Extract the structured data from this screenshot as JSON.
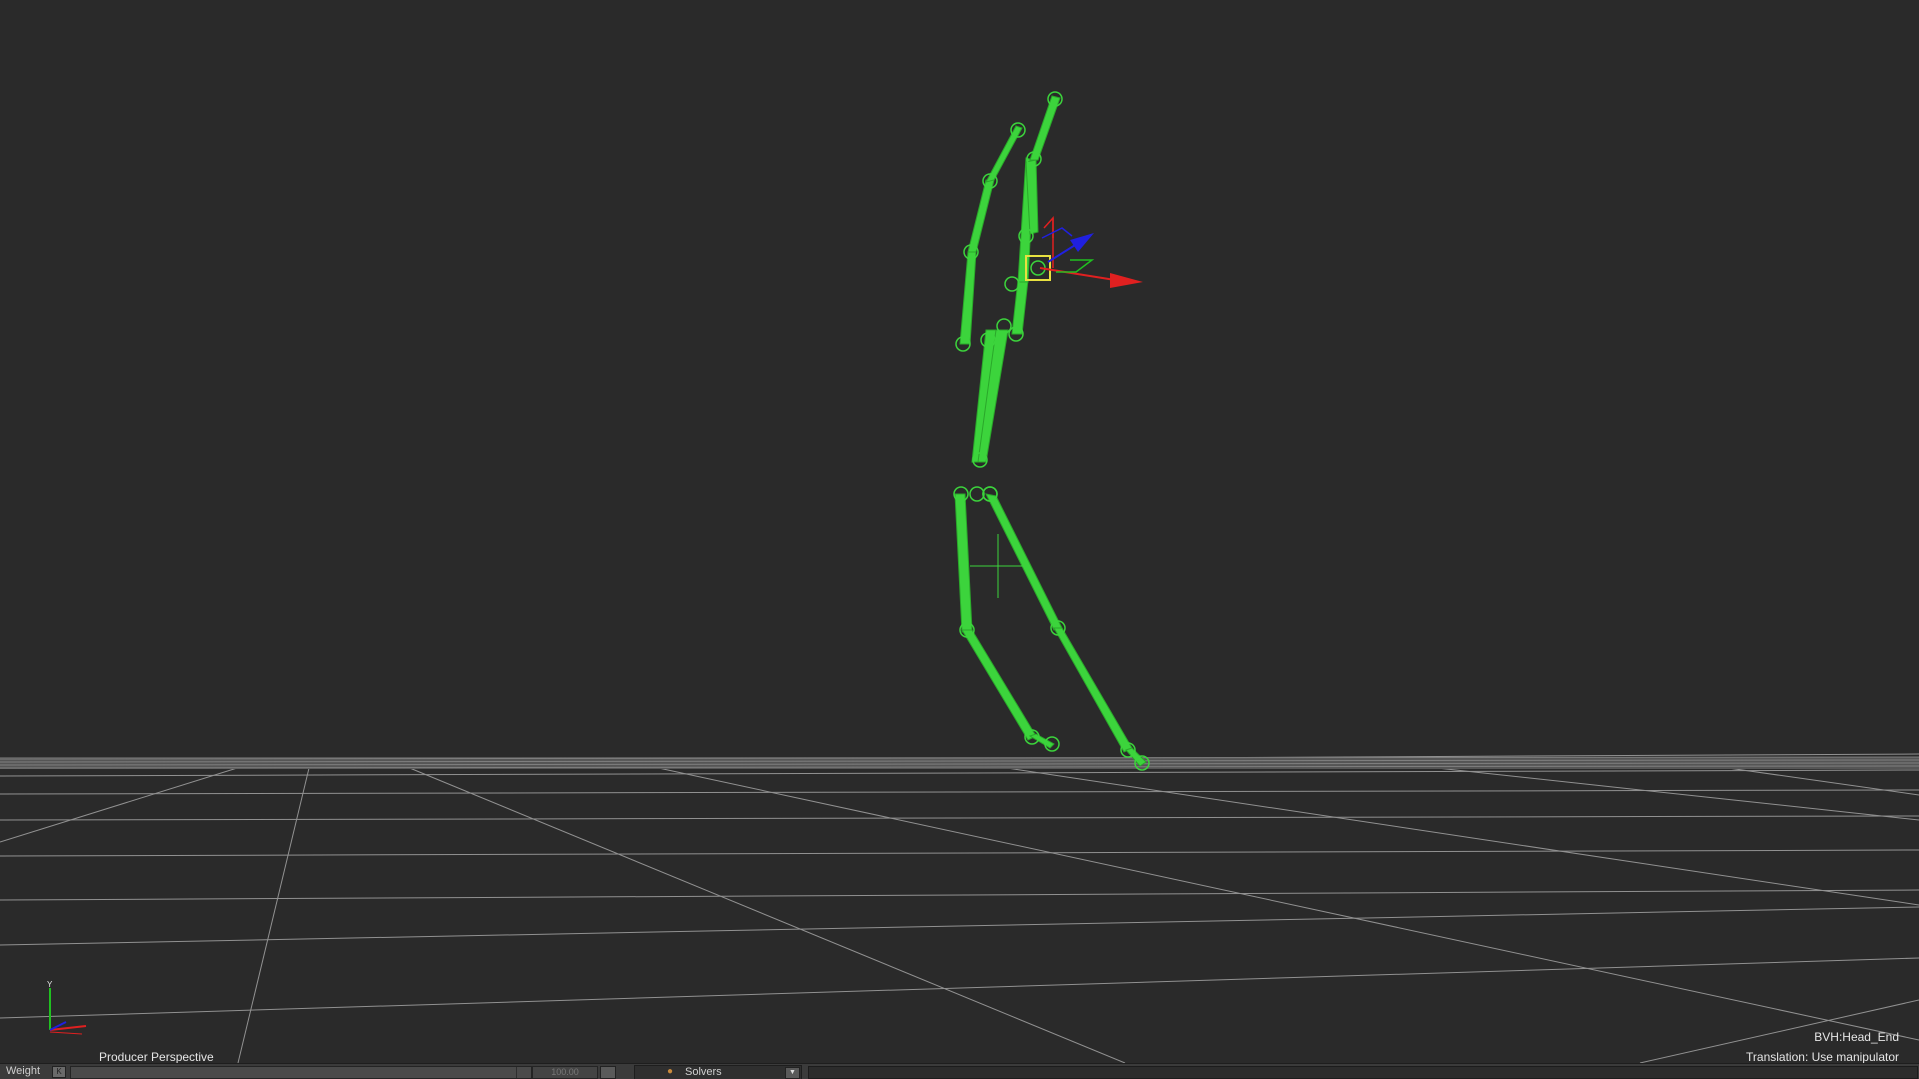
{
  "viewport": {
    "camera_name": "Producer Perspective",
    "selected_object": "BVH:Head_End",
    "manipulator_status": "Translation: Use manipulator",
    "axis_gizmo_label": "Y"
  },
  "statusbar": {
    "weight_label": "Weight",
    "weight_key_glyph": "K",
    "weight_value": "100.00",
    "solvers_label": "Solvers",
    "solvers_dropdown_glyph": "▼"
  },
  "colors": {
    "background": "#2a2a2a",
    "skeleton": "#3cd43c",
    "grid": "#b4b4b4",
    "axis_x": "#e02020",
    "axis_y": "#20c020",
    "axis_z": "#2020e0",
    "selection": "#e8e040"
  }
}
